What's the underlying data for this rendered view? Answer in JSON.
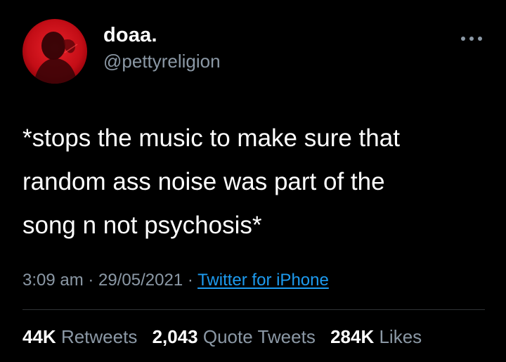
{
  "tweet": {
    "author": {
      "display_name": "doaa.",
      "handle": "@pettyreligion"
    },
    "text": "*stops the music to make sure that\nrandom ass noise was part of the\nsong n not psychosis*",
    "time": "3:09 am",
    "date": "29/05/2021",
    "separator": " · ",
    "source": "Twitter for iPhone",
    "stats": {
      "retweets_count": "44K",
      "retweets_label": "Retweets",
      "quotes_count": "2,043",
      "quotes_label": "Quote Tweets",
      "likes_count": "284K",
      "likes_label": "Likes"
    }
  },
  "icons": {
    "more": "more-horizontal-icon"
  },
  "colors": {
    "background": "#000000",
    "text_primary": "#ffffff",
    "text_secondary": "#8b98a5",
    "link": "#1d9bf0",
    "avatar_red": "#d4101a"
  }
}
